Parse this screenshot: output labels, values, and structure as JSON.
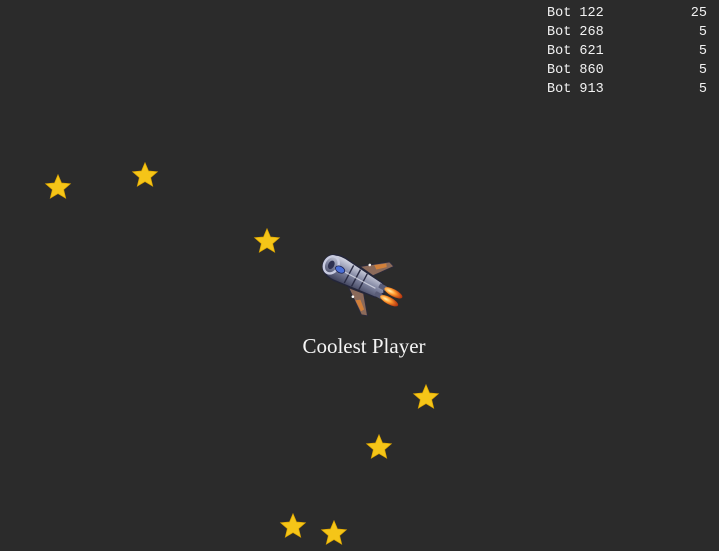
{
  "leaderboard": [
    {
      "name": "Bot 122",
      "score": "25"
    },
    {
      "name": "Bot 268",
      "score": "5"
    },
    {
      "name": "Bot 621",
      "score": "5"
    },
    {
      "name": "Bot 860",
      "score": "5"
    },
    {
      "name": "Bot 913",
      "score": "5"
    }
  ],
  "player": {
    "name": "Coolest Player",
    "icon": "spaceship-icon"
  },
  "collectible_icon": "star-icon",
  "colors": {
    "background": "#2b2b2b",
    "star": "#f5c518",
    "text": "#f2f2f2"
  }
}
